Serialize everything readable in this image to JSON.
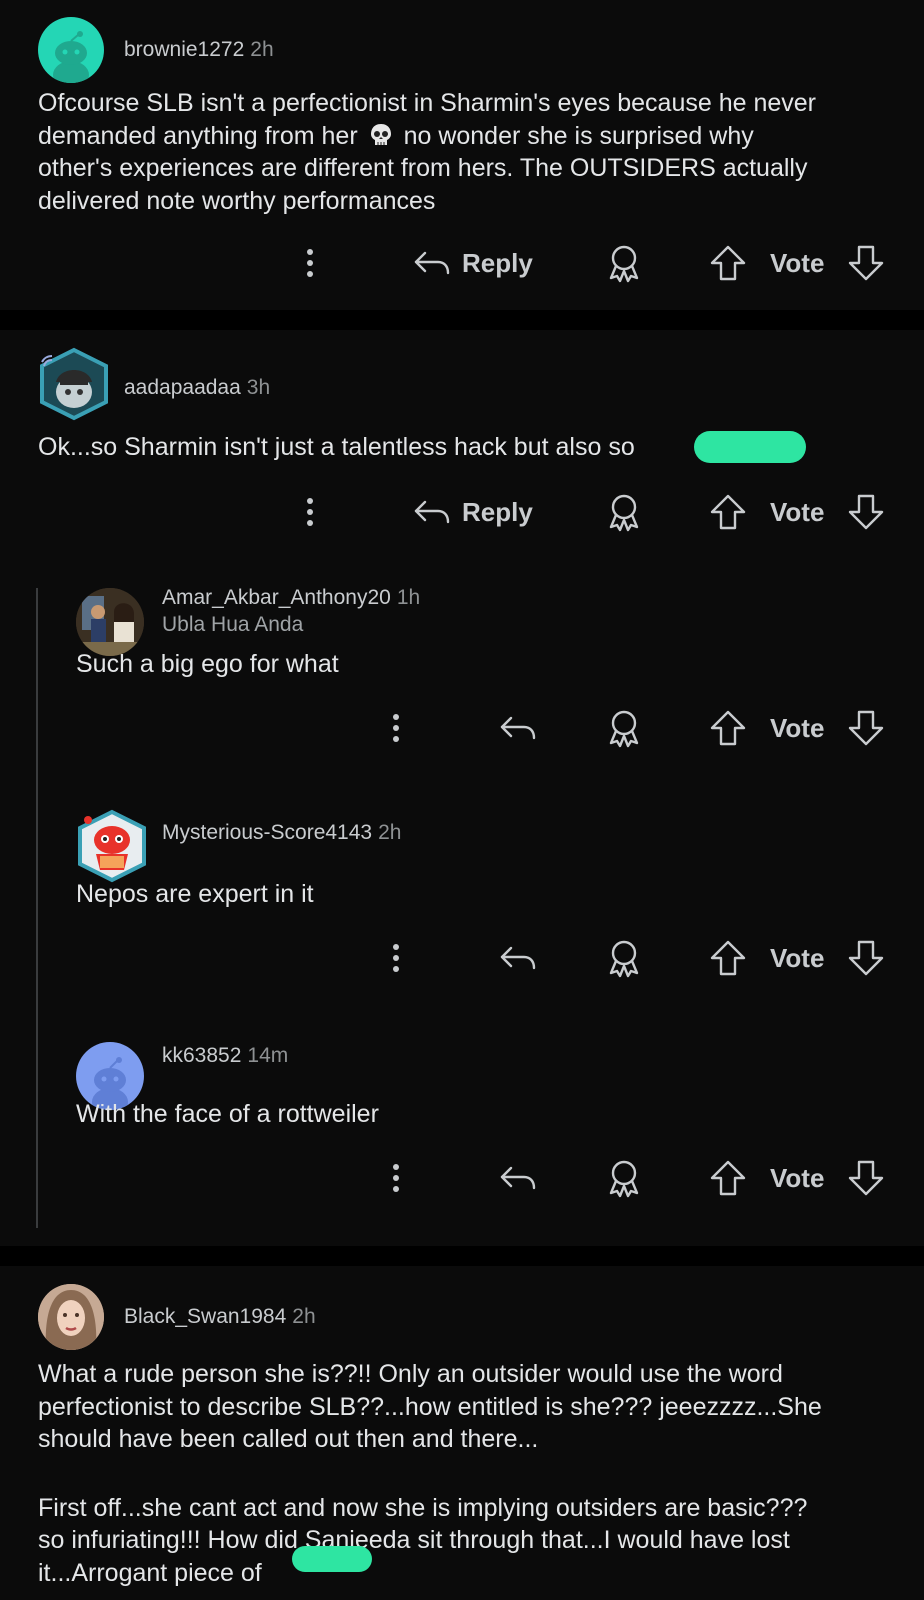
{
  "comments": [
    {
      "username": "brownie1272",
      "time": "2h",
      "body_line1": "Ofcourse SLB isn't a perfectionist in Sharmin's eyes because he never",
      "body_line2a": "demanded anything from her",
      "body_line2b": "no wonder she is surprised why",
      "body_line3": "other's experiences are different from hers. The OUTSIDERS actually",
      "body_line4": "delivered note worthy performances",
      "reply_label": "Reply",
      "vote_label": "Vote"
    },
    {
      "username": "aadapaadaa",
      "time": "3h",
      "body_line1": "Ok...so Sharmin isn't just a talentless hack but also so",
      "reply_label": "Reply",
      "vote_label": "Vote"
    },
    {
      "username": "Amar_Akbar_Anthony20",
      "time": "1h",
      "flair": "Ubla Hua Anda",
      "body_line1": "Such a big ego for what",
      "vote_label": "Vote"
    },
    {
      "username": "Mysterious-Score4143",
      "time": "2h",
      "body_line1": "Nepos are expert in it",
      "vote_label": "Vote"
    },
    {
      "username": "kk63852",
      "time": "14m",
      "body_line1": "With the face of a rottweiler",
      "vote_label": "Vote"
    },
    {
      "username": "Black_Swan1984",
      "time": "2h",
      "body_line1": "What a rude person she is??!! Only an outsider would use the word",
      "body_line2": "perfectionist to describe SLB??...how entitled is she??? jeeezzzz...She",
      "body_line3": "should have been called out then and there...",
      "body_line4": "First off...she cant act and now she is implying outsiders are basic???",
      "body_line5": "so infuriating!!! How did Sanjeeda sit through that...I would have lost",
      "body_line6": "it...Arrogant piece of"
    }
  ],
  "colors": {
    "background": "#000000",
    "card": "#0b0b0b",
    "text": "#e4e6e8",
    "muted": "#8e9193",
    "redaction": "#2ee5a2",
    "snoo_teal": "#24d6b5",
    "snoo_blue": "#7e9df0"
  },
  "icons": [
    "skull-emoji",
    "more-icon",
    "reply-icon",
    "award-icon",
    "upvote-icon",
    "downvote-icon",
    "snoo-avatar"
  ]
}
